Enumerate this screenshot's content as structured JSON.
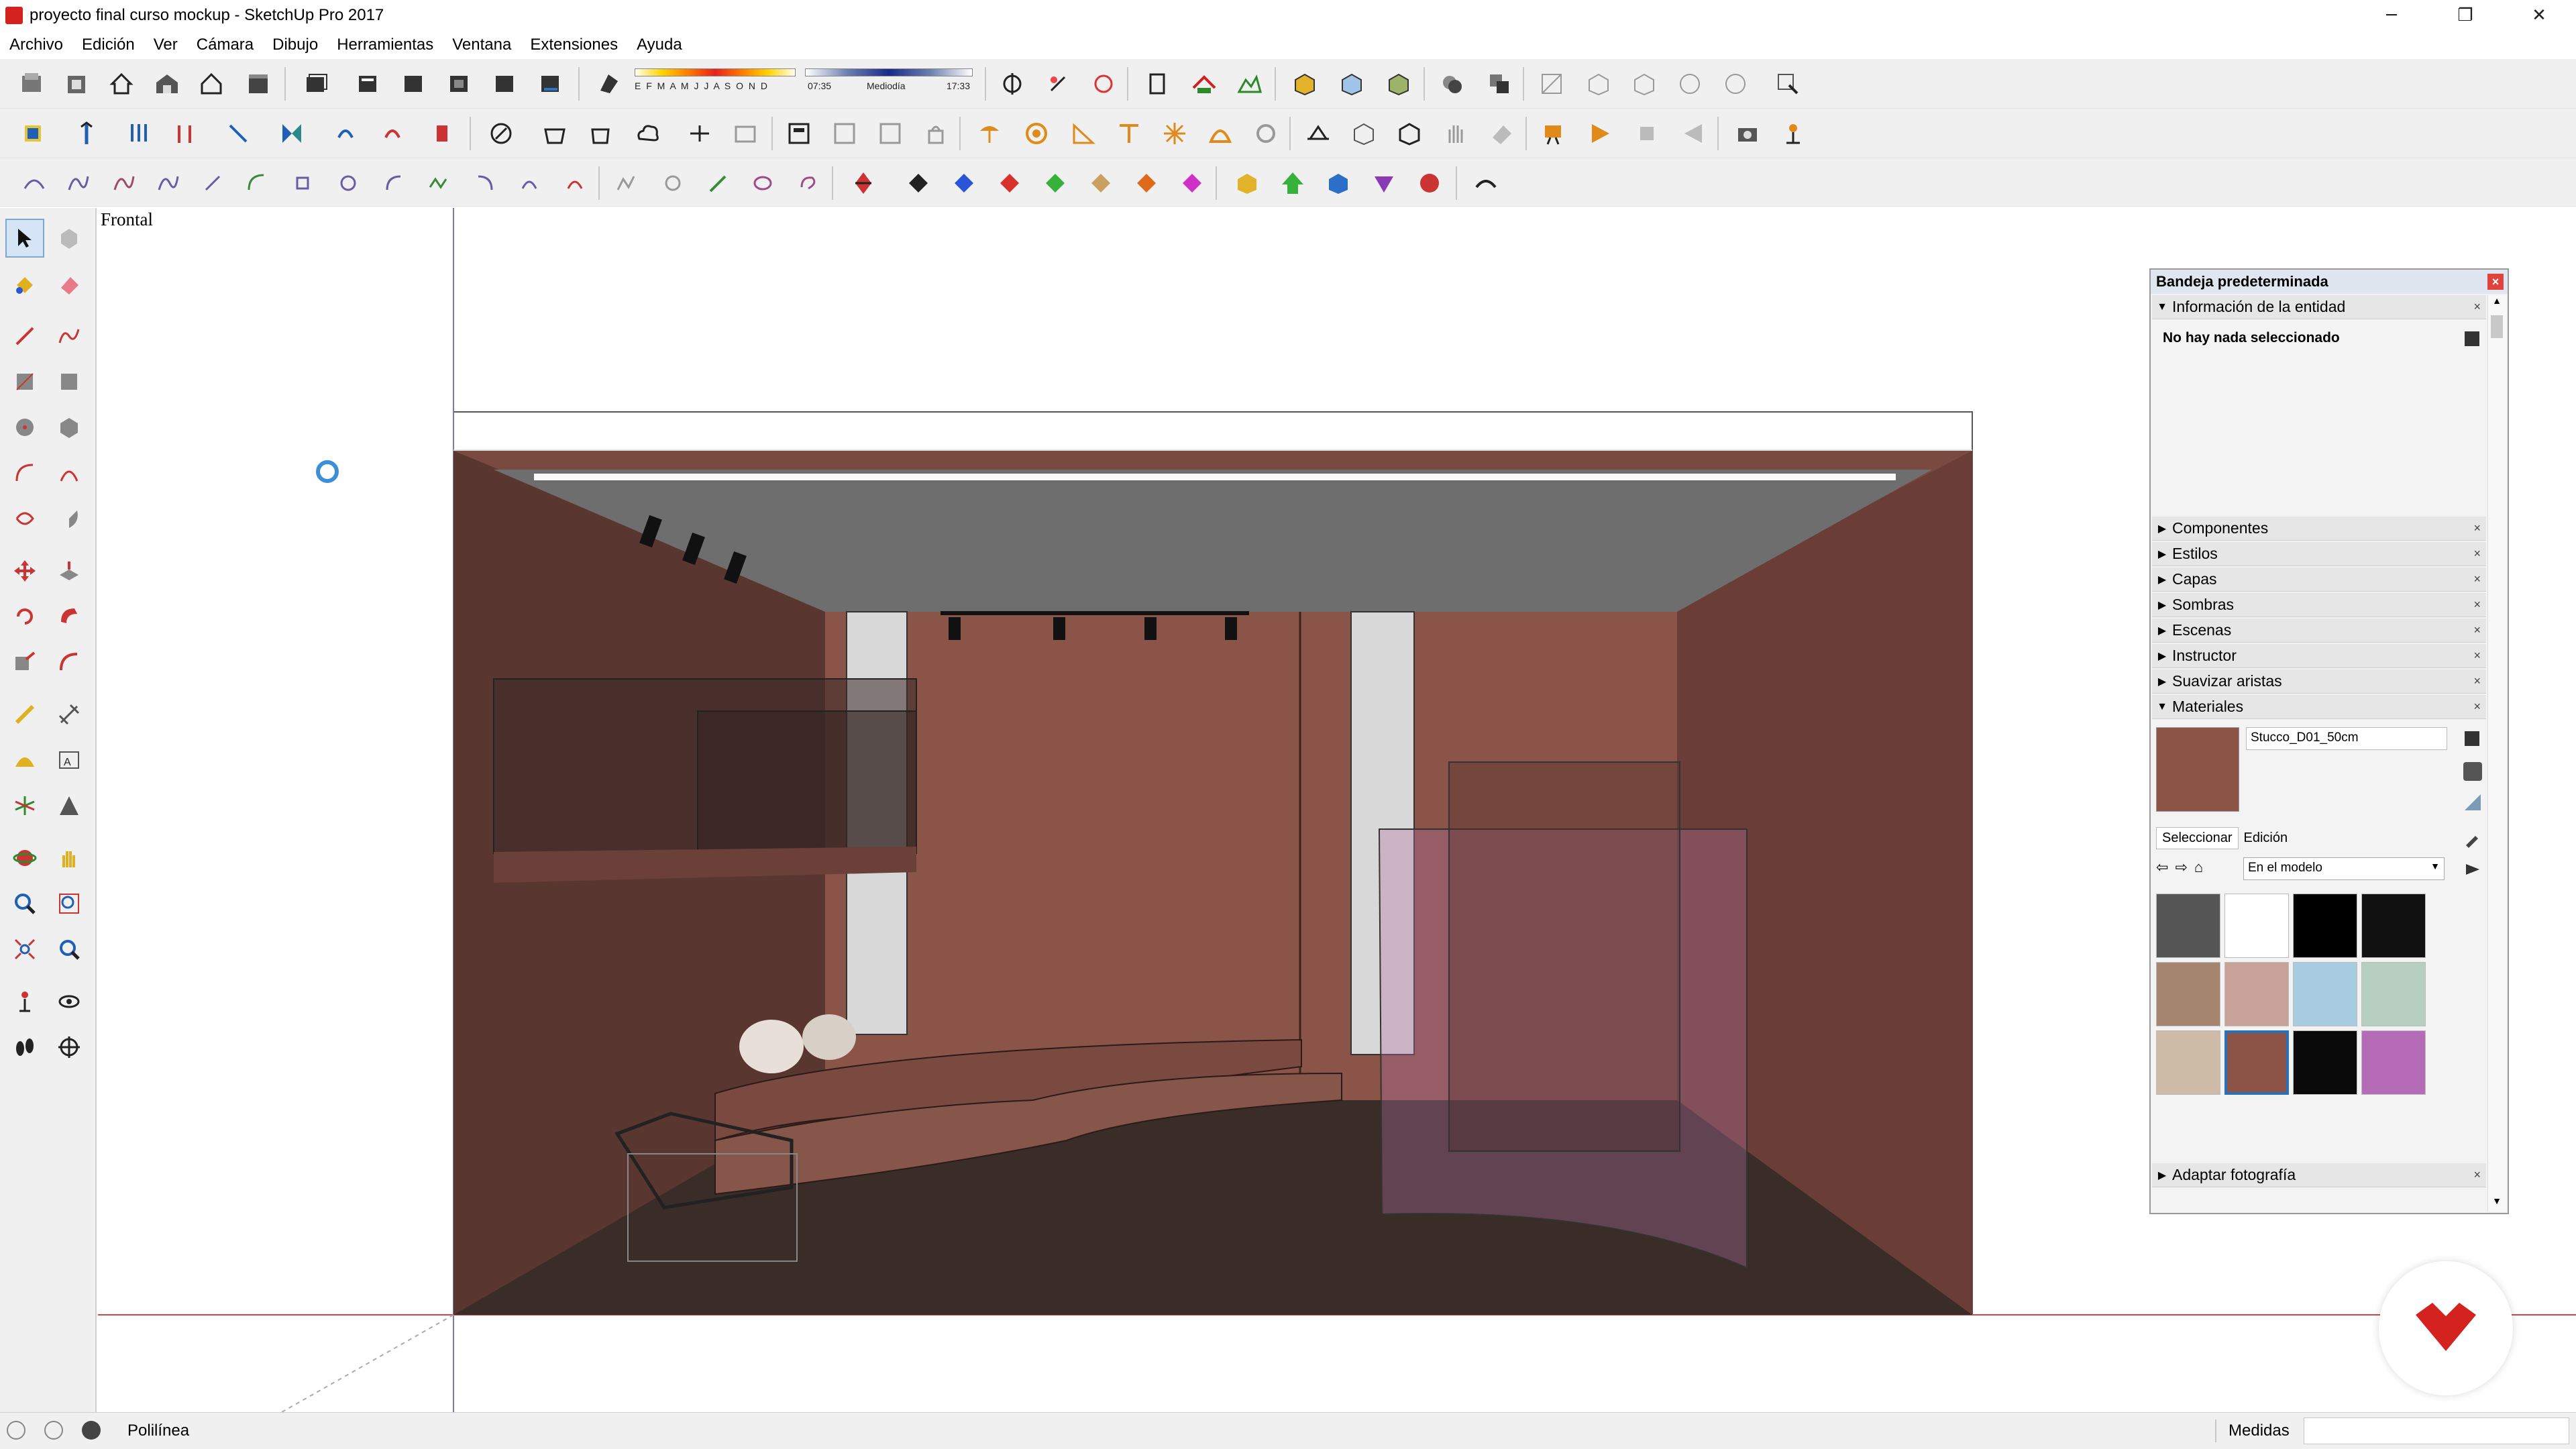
{
  "window": {
    "title": "proyecto final curso mockup - SketchUp Pro 2017",
    "minimize": "─",
    "restore": "❐",
    "close": "✕"
  },
  "menu": [
    "Archivo",
    "Edición",
    "Ver",
    "Cámara",
    "Dibujo",
    "Herramientas",
    "Ventana",
    "Extensiones",
    "Ayuda"
  ],
  "toolbar": {
    "shadow_months": "E F M A M J J A S O N D",
    "time_start": "07:35",
    "time_mid": "Mediodía",
    "time_end": "17:33"
  },
  "viewport": {
    "scene_tab": "Frontal"
  },
  "tray": {
    "title": "Bandeja predeterminada",
    "entity_info": {
      "label": "Información de la entidad",
      "message": "No hay nada seleccionado"
    },
    "sections": [
      "Componentes",
      "Estilos",
      "Capas",
      "Sombras",
      "Escenas",
      "Instructor",
      "Suavizar aristas"
    ],
    "materials": {
      "label": "Materiales",
      "current_name": "Stucco_D01_50cm",
      "tab_select": "Seleccionar",
      "tab_edit": "Edición",
      "collection": "En el modelo",
      "swatches": [
        "#555555",
        "#ffffff",
        "#000000",
        "#111111",
        "#a58570",
        "#c9a39a",
        "#a9cde0",
        "#b7cfc0",
        "#cdbba7",
        "#8b5447",
        "#0a0a0a",
        "#b66bb6"
      ],
      "selected_swatch_index": 9
    },
    "bottom_section": "Adaptar fotografía"
  },
  "status": {
    "tool": "Polilínea",
    "measures_label": "Medidas"
  },
  "colors": {
    "wall": "#7a4a40",
    "floor": "#3a2c27",
    "ceiling": "#6e6e6e",
    "glass": "#b070a0",
    "brand_red": "#d4221e"
  }
}
